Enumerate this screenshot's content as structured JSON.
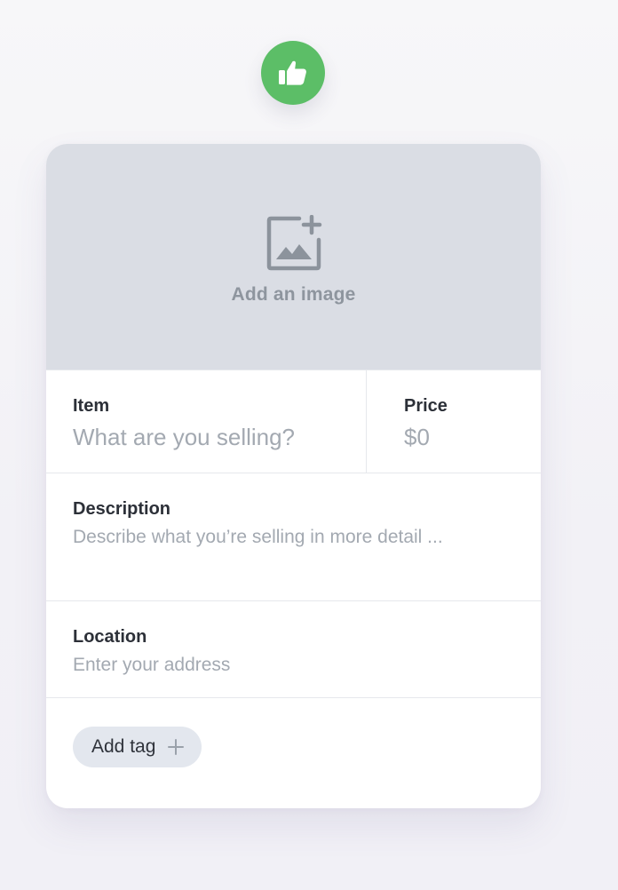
{
  "header": {
    "badge_icon": "thumbs-up-icon",
    "badge_color": "#5cbe67"
  },
  "image_upload": {
    "label": "Add an image",
    "icon": "add-image-icon",
    "background_color": "#dadde4"
  },
  "fields": {
    "item": {
      "label": "Item",
      "value": "",
      "placeholder": "What are you selling?"
    },
    "price": {
      "label": "Price",
      "value": "",
      "placeholder": "$0"
    },
    "description": {
      "label": "Description",
      "value": "",
      "placeholder": "Describe what you’re selling in more detail ..."
    },
    "location": {
      "label": "Location",
      "value": "",
      "placeholder": "Enter your address"
    }
  },
  "tags": {
    "add_label": "Add tag",
    "add_icon": "plus-icon"
  }
}
